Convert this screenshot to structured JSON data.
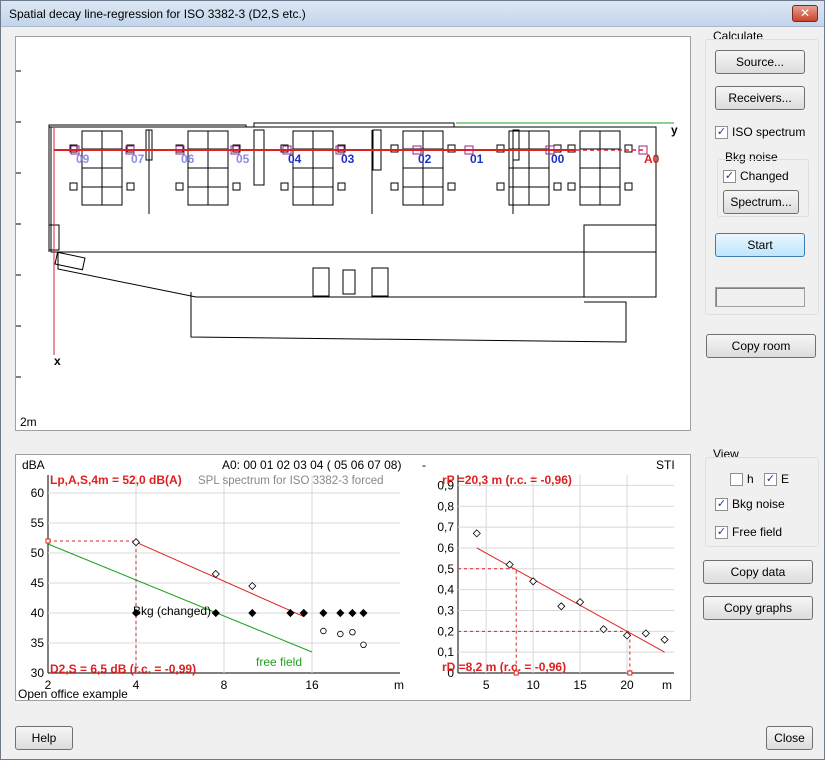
{
  "window": {
    "title": "Spatial decay line-regression for ISO 3382-3 (D2,S etc.)"
  },
  "calculate": {
    "heading": "Calculate",
    "source_label": "Source...",
    "receivers_label": "Receivers...",
    "iso_spectrum_label": "ISO spectrum",
    "iso_spectrum_checked": true,
    "bkg_heading": "Bkg noise",
    "changed_label": "Changed",
    "changed_checked": true,
    "spectrum_label": "Spectrum...",
    "start_label": "Start",
    "copy_room_label": "Copy room"
  },
  "view": {
    "heading": "View",
    "h_label": "h",
    "h_checked": false,
    "e_label": "E",
    "e_checked": true,
    "bkg_noise_label": "Bkg noise",
    "bkg_noise_checked": true,
    "free_field_label": "Free field",
    "free_field_checked": true,
    "copy_data_label": "Copy data",
    "copy_graphs_label": "Copy graphs"
  },
  "footer": {
    "help_label": "Help",
    "close_label": "Close"
  },
  "plan": {
    "axis_y": "y",
    "axis_x": "x",
    "scale": "2m",
    "receivers": [
      {
        "label": "09",
        "color": "#8a8ee0"
      },
      {
        "label": "07",
        "color": "#8a8ee0"
      },
      {
        "label": "06",
        "color": "#8a8ee0"
      },
      {
        "label": "05",
        "color": "#8a8ee0"
      },
      {
        "label": "04",
        "color": "#1c2fc8"
      },
      {
        "label": "03",
        "color": "#1c2fc8"
      },
      {
        "label": "02",
        "color": "#1c2fc8"
      },
      {
        "label": "01",
        "color": "#1c2fc8"
      },
      {
        "label": "00",
        "color": "#1c2fc8"
      },
      {
        "label": "A0",
        "color": "#e02020"
      }
    ]
  },
  "colors": {
    "regression": "#e02020",
    "free_field": "#1ea01e",
    "receiver_blue": "#1c2fc8"
  },
  "chart_data": [
    {
      "type": "scatter",
      "unit_label": "dBA",
      "header": "A0:  00 01 02 03 04 ( 05 06 07 08)",
      "subtitle": "SPL spectrum for ISO 3382-3 forced",
      "xlabel": "m",
      "x_scale": "log2",
      "x_ticks": [
        "2",
        "4",
        "8",
        "16"
      ],
      "y_ticks": [
        "30",
        "35",
        "40",
        "45",
        "50",
        "55",
        "60"
      ],
      "xlim": [
        2,
        32
      ],
      "ylim": [
        30,
        63
      ],
      "annotation_top": "Lp,A,S,4m = 52,0 dB(A)",
      "annotation_bottom": "D2,S = 6,5 dB (r.c. = -0,99)",
      "bkg_label": "Bkg (changed)",
      "free_field_label": "free field",
      "series": [
        {
          "name": "",
          "marker": "open-diamond",
          "x": [
            4,
            7.5,
            10,
            15
          ],
          "y": [
            51.8,
            46.5,
            44.5,
            40.0
          ]
        },
        {
          "name": "",
          "marker": "open-circle",
          "x": [
            17.5,
            20,
            22,
            24
          ],
          "y": [
            37.0,
            36.5,
            36.8,
            34.7
          ]
        },
        {
          "name": "Bkg (changed)",
          "marker": "filled-diamond",
          "x": [
            4,
            7.5,
            10,
            13.5,
            15,
            17.5,
            20,
            22,
            24
          ],
          "y": [
            40,
            40,
            40,
            40,
            40,
            40,
            40,
            40,
            40
          ]
        }
      ],
      "regression": {
        "x": [
          4,
          15
        ],
        "y": [
          51.8,
          39.4
        ]
      },
      "free_field": {
        "x": [
          2,
          16
        ],
        "y": [
          51.5,
          33.5
        ]
      },
      "ref_point": {
        "x": 4,
        "y": 52.0
      }
    },
    {
      "type": "scatter",
      "unit_label": "-",
      "header": "STI",
      "xlabel": "m",
      "x_ticks": [
        "5",
        "10",
        "15",
        "20"
      ],
      "y_ticks": [
        "0",
        "0,1",
        "0,2",
        "0,3",
        "0,4",
        "0,5",
        "0,6",
        "0,7",
        "0,8",
        "0,9"
      ],
      "xlim": [
        2,
        25
      ],
      "ylim": [
        0,
        0.95
      ],
      "annotation_top": "rP =20,3 m (r.c. = -0,96)",
      "annotation_bottom": "rD =8,2 m (r.c. = -0,96)",
      "series": [
        {
          "name": "",
          "marker": "open-diamond",
          "x": [
            4,
            7.5,
            10,
            13,
            15,
            17.5,
            20,
            22,
            24
          ],
          "y": [
            0.67,
            0.52,
            0.44,
            0.32,
            0.34,
            0.21,
            0.18,
            0.19,
            0.16
          ]
        }
      ],
      "regression": {
        "x": [
          4,
          24
        ],
        "y": [
          0.6,
          0.1
        ]
      },
      "ref_lines": [
        {
          "x": 8.2,
          "y": 0.5
        },
        {
          "x": 20.3,
          "y": 0.2
        }
      ]
    }
  ],
  "example_label": "Open office example"
}
